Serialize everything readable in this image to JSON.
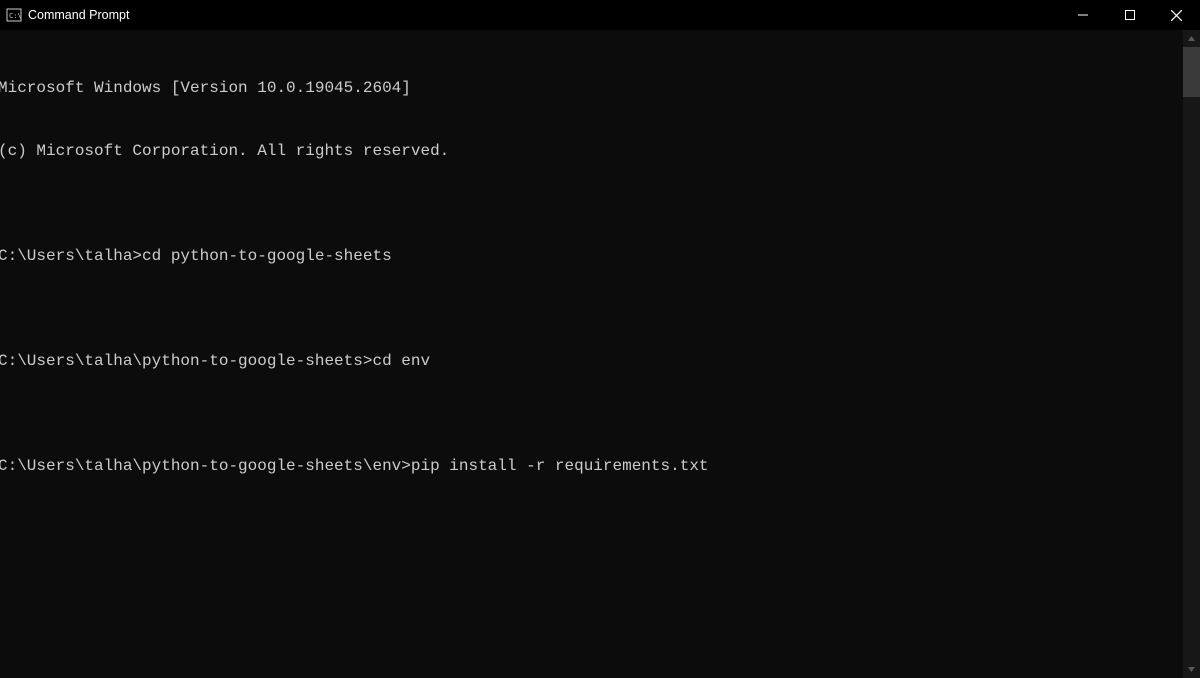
{
  "titlebar": {
    "title": "Command Prompt"
  },
  "terminal": {
    "lines": [
      "Microsoft Windows [Version 10.0.19045.2604]",
      "(c) Microsoft Corporation. All rights reserved.",
      "",
      "C:\\Users\\talha>cd python-to-google-sheets",
      "",
      "C:\\Users\\talha\\python-to-google-sheets>cd env",
      "",
      "C:\\Users\\talha\\python-to-google-sheets\\env>pip install -r requirements.txt"
    ]
  }
}
